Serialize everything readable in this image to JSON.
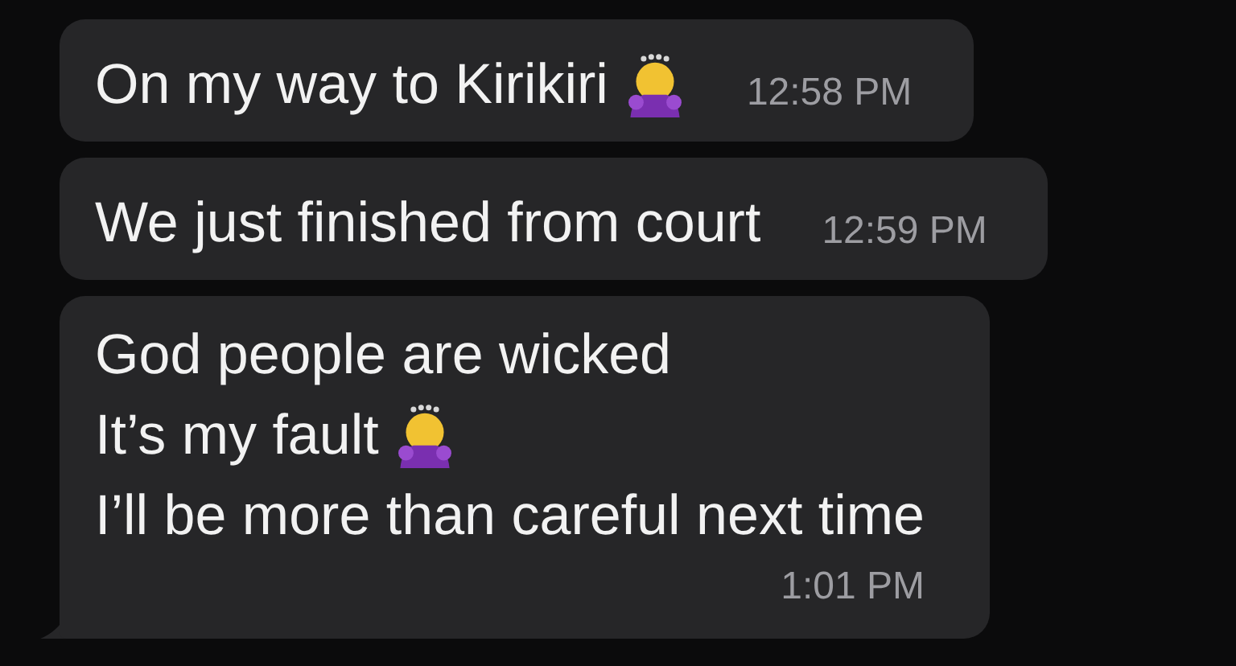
{
  "messages": [
    {
      "lines": [
        {
          "text": "On my way to Kirikiri",
          "kind": "with-emoji"
        }
      ],
      "time": "12:58 PM",
      "tail": false
    },
    {
      "lines": [
        {
          "text": "We just finished from court",
          "kind": "plain"
        }
      ],
      "time": "12:59 PM",
      "tail": false
    },
    {
      "lines": [
        {
          "text": "God people are wicked",
          "kind": "plain"
        },
        {
          "text": "It’s my fault",
          "kind": "with-emoji"
        },
        {
          "text": "I’ll be more than careful next time",
          "kind": "plain"
        }
      ],
      "time": "1:01 PM",
      "tail": true
    }
  ]
}
